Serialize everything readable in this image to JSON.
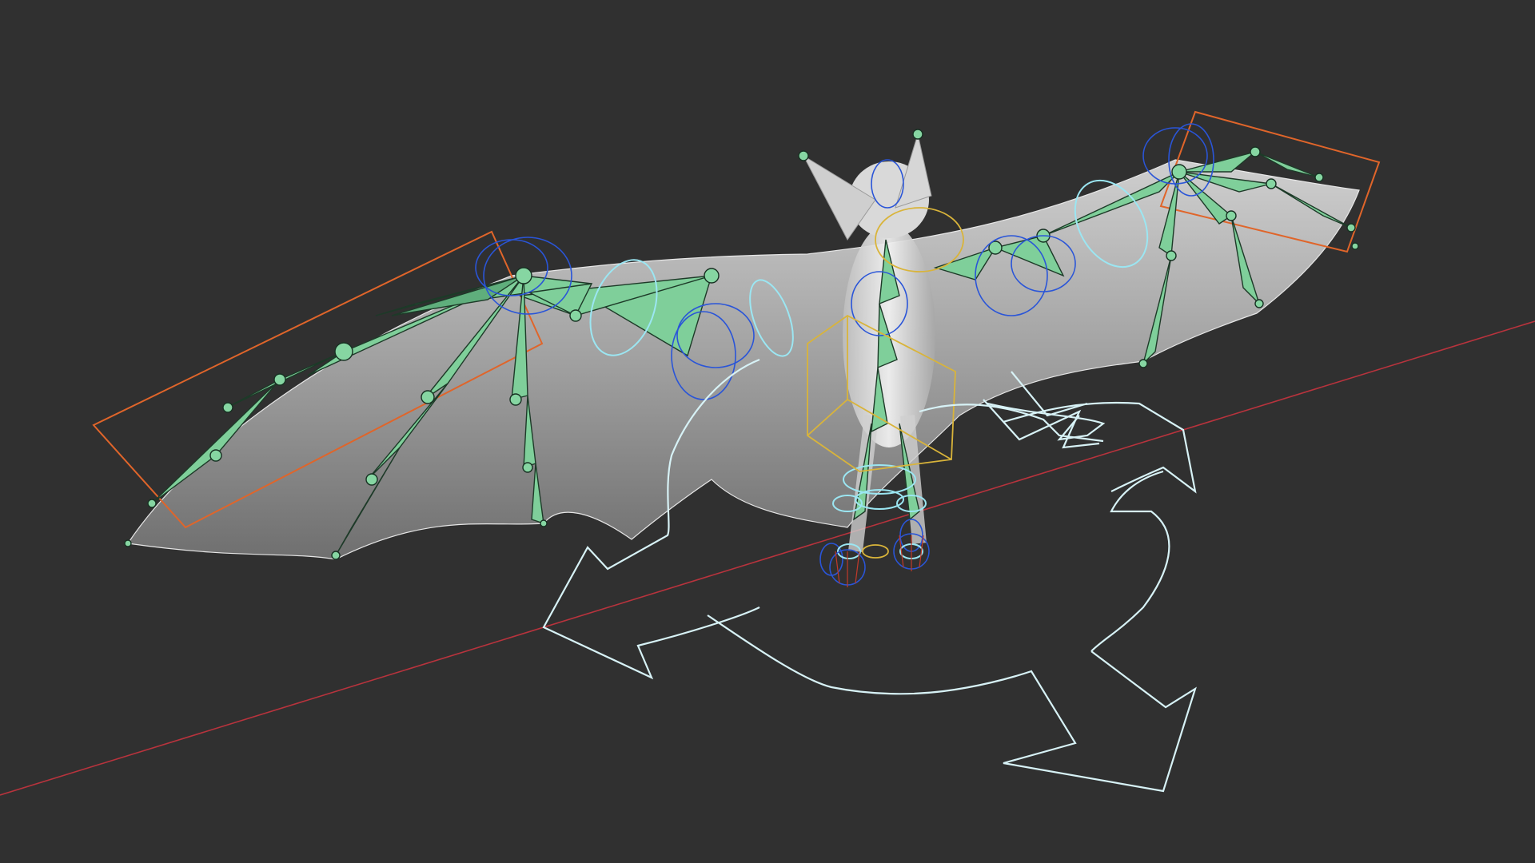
{
  "viewport": {
    "mode": "pose",
    "subject": "bat-rig",
    "colors": {
      "background": "#303030",
      "wing_membrane": "#a9a9a9",
      "bone": "#7fcf9a",
      "control_blue": "#2a55d8",
      "control_cyan": "#9be6f2",
      "control_yellow": "#d9b43a",
      "control_orange": "#e0652a",
      "axis_x": "#b8333d",
      "gizmo": "#d7f2f6"
    },
    "icons": [
      "rotate-gizmo-icon"
    ]
  }
}
